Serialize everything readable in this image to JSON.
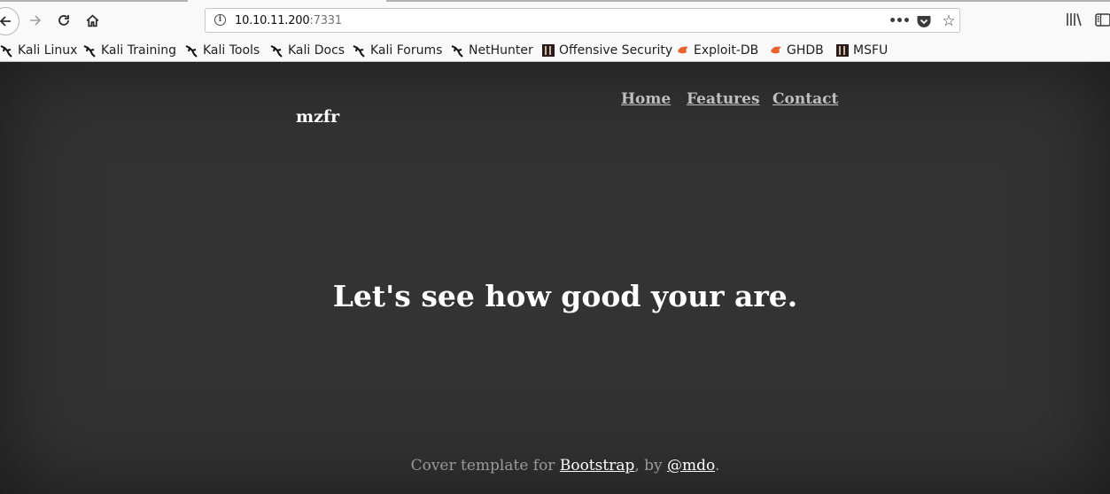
{
  "browser": {
    "url_host": "10.10.11.200",
    "url_port": ":7331",
    "bookmarks": [
      {
        "label": "Kali Linux",
        "icon": "kali-dragon-icon"
      },
      {
        "label": "Kali Training",
        "icon": "kali-dragon-icon"
      },
      {
        "label": "Kali Tools",
        "icon": "kali-dragon-icon"
      },
      {
        "label": "Kali Docs",
        "icon": "kali-dragon-icon"
      },
      {
        "label": "Kali Forums",
        "icon": "kali-dragon-icon"
      },
      {
        "label": "NetHunter",
        "icon": "kali-dragon-icon"
      },
      {
        "label": "Offensive Security",
        "icon": "offsec-icon"
      },
      {
        "label": "Exploit-DB",
        "icon": "exploit-db-icon"
      },
      {
        "label": "GHDB",
        "icon": "exploit-db-icon"
      },
      {
        "label": "MSFU",
        "icon": "offsec-icon"
      }
    ]
  },
  "page": {
    "brand": "mzfr",
    "nav": {
      "home": "Home",
      "features": "Features",
      "contact": "Contact"
    },
    "headline": "Let's see how good your are.",
    "footer": {
      "prefix": "Cover template for ",
      "link1": "Bootstrap",
      "middle": ", by ",
      "link2": "@mdo",
      "suffix": "."
    }
  },
  "colors": {
    "background": "#333333",
    "nav_link": "#bfbfbf",
    "text": "#ffffff",
    "footer_text": "#9a9a9a"
  }
}
